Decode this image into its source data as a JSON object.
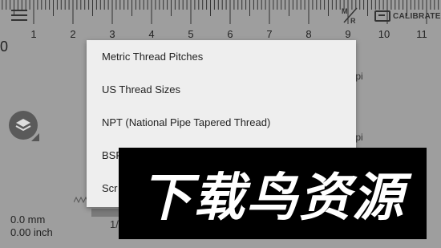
{
  "ruler": {
    "numbers": [
      "1",
      "2",
      "3",
      "4",
      "5",
      "6",
      "7",
      "8",
      "9",
      "10",
      "11"
    ]
  },
  "toolbar": {
    "menu_icon": "hamburger-menu-icon",
    "units_icon": "metric-imperial-toggle-icon",
    "calibrate_label": "CALIBRATE"
  },
  "background": {
    "zero_label": "0",
    "tpi_1": "tpi",
    "tpi_2": "tpi",
    "partial_14": "1/"
  },
  "measurement": {
    "mm": "0.0 mm",
    "inch": "0.00 inch"
  },
  "dropdown": {
    "items": [
      {
        "label": "Metric Thread Pitches"
      },
      {
        "label": "US Thread Sizes"
      },
      {
        "label": "NPT (National Pipe Tapered Thread)"
      },
      {
        "label": "BSP"
      },
      {
        "label": "Scr"
      }
    ]
  },
  "watermark": {
    "text": "下载鸟资源"
  },
  "colors": {
    "dim_background": "#9e9e9e",
    "dropdown_bg": "#eeeeee",
    "text": "#222222",
    "watermark_bg": "#000000"
  }
}
